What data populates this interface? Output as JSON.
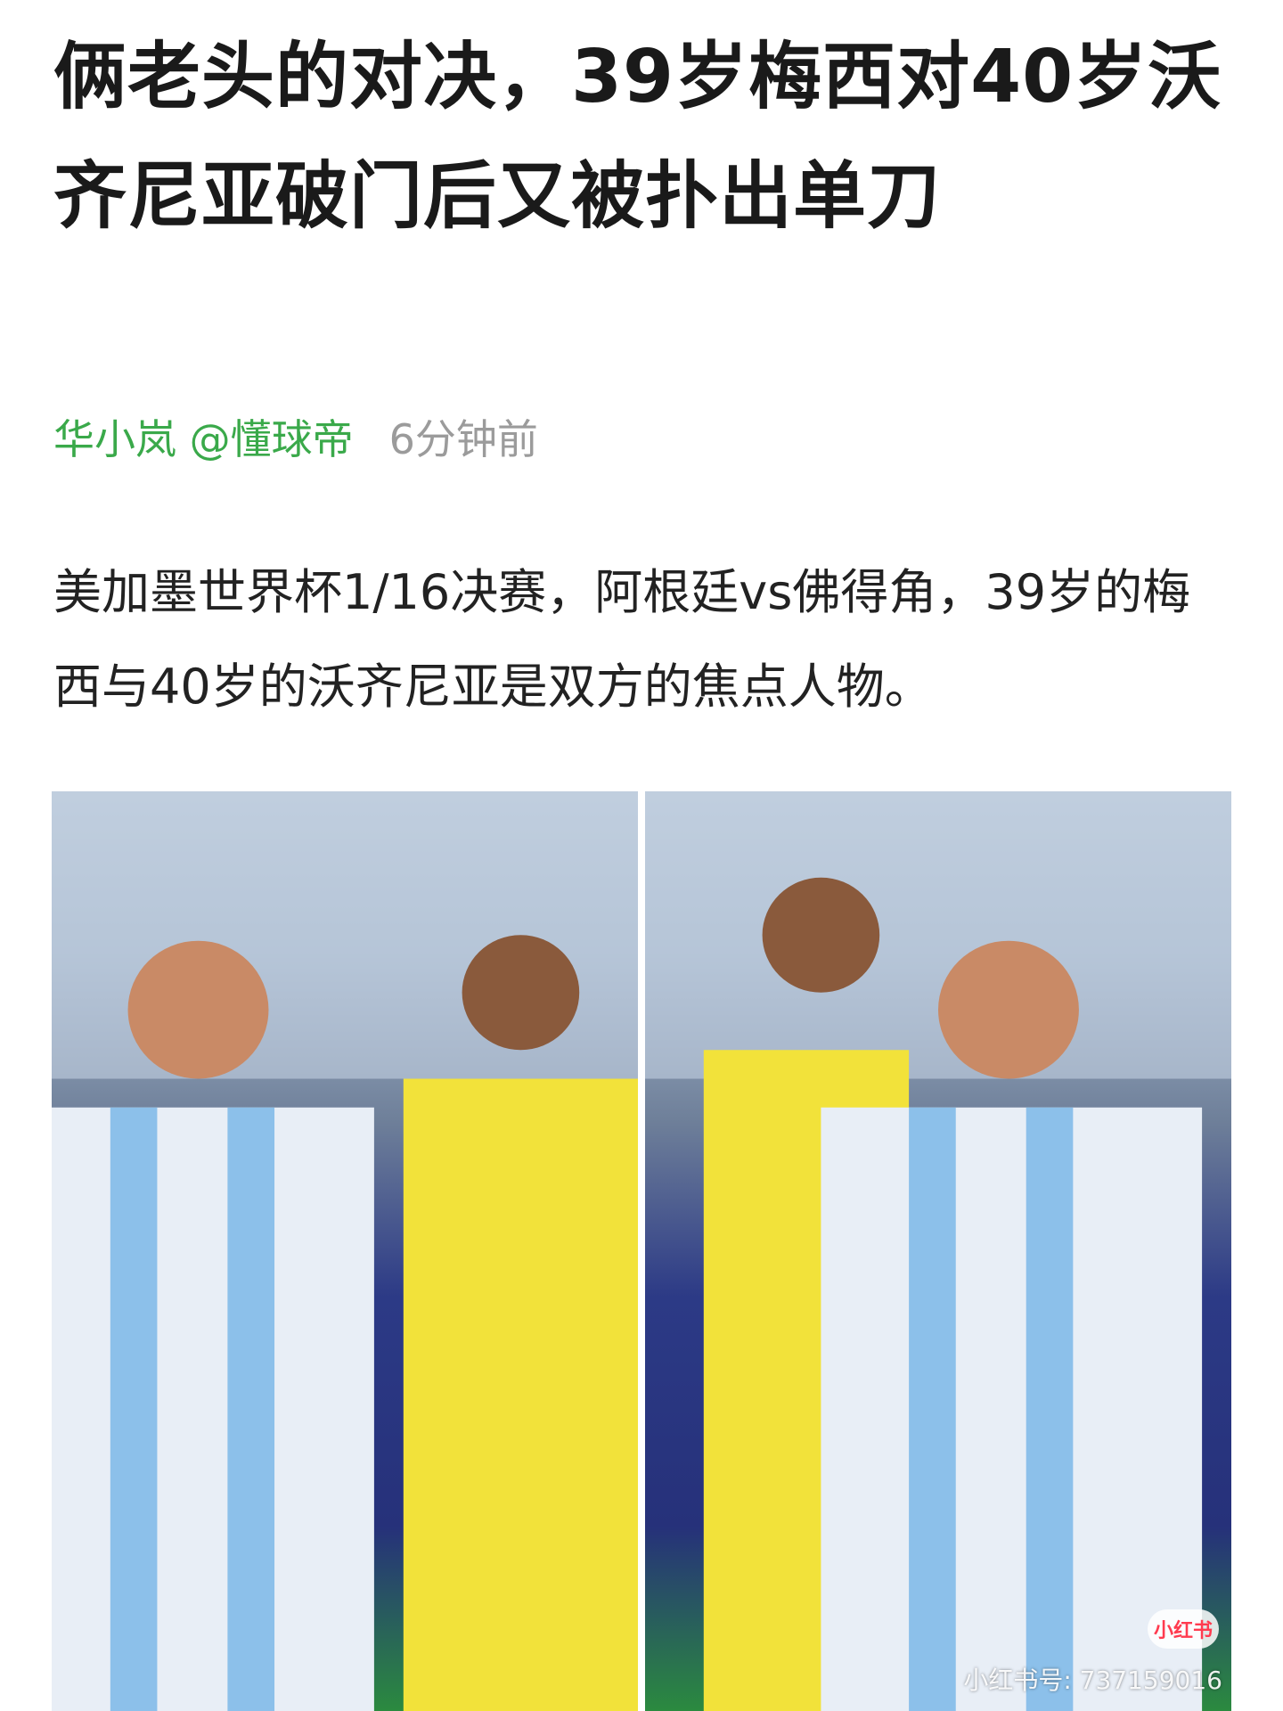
{
  "article": {
    "title": "俩老头的对决，39岁梅西对40岁沃齐尼亚破门后又被扑出单刀",
    "author": "华小岚 @懂球帝",
    "time": "6分钟前",
    "body": "美加墨世界杯1/16决赛，阿根廷vs佛得角，39岁的梅西与40岁的沃齐尼亚是双方的焦点人物。"
  },
  "photo": {
    "watermark_logo": "小红书",
    "watermark_id": "小红书号: 737159016"
  },
  "colors": {
    "author": "#3aa94a",
    "time": "#9b9b9b",
    "title": "#1a1a1a"
  }
}
